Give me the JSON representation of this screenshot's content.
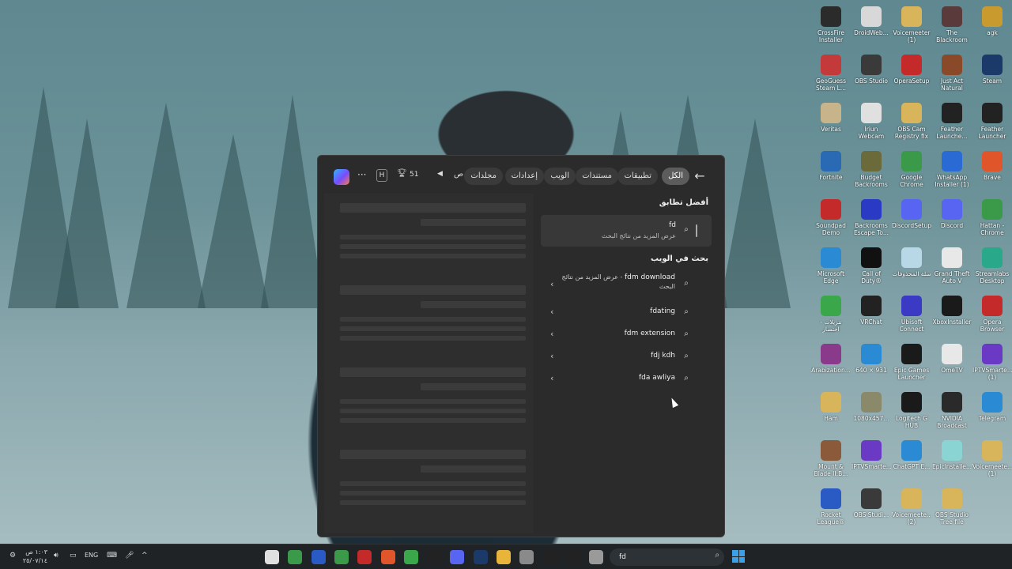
{
  "search_panel": {
    "back_icon": "arrow-left-icon",
    "filters": [
      "الكل",
      "تطبيقات",
      "مستندات",
      "الويب",
      "إعدادات",
      "مجلدات"
    ],
    "active_filter": "الكل",
    "overflow_label": "ص",
    "rewards_points": "51",
    "more_label": "···",
    "profile_initial": "H",
    "best_match": {
      "heading": "أفضل تطابق",
      "query": "fd",
      "subtitle": "عرض المزيد من نتائج البحث"
    },
    "web_search": {
      "heading": "بحث في الويب",
      "suggestions": [
        {
          "text": "fdm download",
          "extra": "- عرض المزيد من نتائج البحث"
        },
        {
          "text": "fdating",
          "extra": ""
        },
        {
          "text": "fdm extension",
          "extra": ""
        },
        {
          "text": "fdj kdh",
          "extra": ""
        },
        {
          "text": "fda awliya",
          "extra": ""
        }
      ]
    }
  },
  "desktop_icons": [
    {
      "label": "CrossFire Installer",
      "color": "#2b2b2b"
    },
    {
      "label": "DroidWeb...",
      "color": "#d8d8d8"
    },
    {
      "label": "Voicemeeter (1)",
      "color": "#d8b45a"
    },
    {
      "label": "The Blackroom",
      "color": "#5a3a3a"
    },
    {
      "label": "agk",
      "color": "#c99a2e"
    },
    {
      "label": "GeoGuess Steam L...",
      "color": "#c43a3a"
    },
    {
      "label": "OBS Studio",
      "color": "#3a3a3a"
    },
    {
      "label": "OperaSetup",
      "color": "#c42a2a"
    },
    {
      "label": "Just Act Natural",
      "color": "#8a4a2a"
    },
    {
      "label": "Steam",
      "color": "#1b3a6a"
    },
    {
      "label": "Veritas",
      "color": "#c8b48a"
    },
    {
      "label": "Iriun Webcam",
      "color": "#e0e0e0"
    },
    {
      "label": "OBS Cam Registry fix",
      "color": "#d8b45a"
    },
    {
      "label": "Feather Launche...",
      "color": "#222222"
    },
    {
      "label": "Feather Launcher",
      "color": "#222222"
    },
    {
      "label": "Fortnite",
      "color": "#2a6ab4"
    },
    {
      "label": "Budget Backrooms",
      "color": "#6a6a3a"
    },
    {
      "label": "Google Chrome",
      "color": "#3a9a4a"
    },
    {
      "label": "WhatsApp Installer (1)",
      "color": "#2a6ad4"
    },
    {
      "label": "Brave",
      "color": "#e0552a"
    },
    {
      "label": "Soundpad Demo",
      "color": "#c42a2a"
    },
    {
      "label": "Backrooms Escape To...",
      "color": "#2a3ac4"
    },
    {
      "label": "DiscordSetup",
      "color": "#5865f2"
    },
    {
      "label": "Discord",
      "color": "#5865f2"
    },
    {
      "label": "Hattan - Chrome",
      "color": "#3a9a4a"
    },
    {
      "label": "Microsoft Edge",
      "color": "#2a8ad4"
    },
    {
      "label": "Call of Duty®",
      "color": "#111111"
    },
    {
      "label": "سلة المحذوفات",
      "color": "#b8d8e8"
    },
    {
      "label": "Grand Theft Auto V",
      "color": "#e8e8e8"
    },
    {
      "label": "Streamlabs Desktop",
      "color": "#2aa88a"
    },
    {
      "label": "تنزيلات - اختصار",
      "color": "#3aa84a"
    },
    {
      "label": "VRChat",
      "color": "#222222"
    },
    {
      "label": "Ubisoft Connect",
      "color": "#3a3ac4"
    },
    {
      "label": "XboxInstaller",
      "color": "#1a1a1a"
    },
    {
      "label": "Opera Browser",
      "color": "#c42a2a"
    },
    {
      "label": "Arabization...",
      "color": "#8a3a8a"
    },
    {
      "label": "640 × 931",
      "color": "#2a8ad4"
    },
    {
      "label": "Epic Games Launcher",
      "color": "#1a1a1a"
    },
    {
      "label": "OmeTV",
      "color": "#e8e8e8"
    },
    {
      "label": "IPTVSmarte... (1)",
      "color": "#6a3ac4"
    },
    {
      "label": "Ham",
      "color": "#d8b45a"
    },
    {
      "label": "1080x457...",
      "color": "#8a8a6a"
    },
    {
      "label": "Logitech G HUB",
      "color": "#1a1a1a"
    },
    {
      "label": "NVIDIA Broadcast",
      "color": "#2a2a2a"
    },
    {
      "label": "Telegram",
      "color": "#2a8ad4"
    },
    {
      "label": "Mount & Blade II:B...",
      "color": "#8a5a3a"
    },
    {
      "label": "IPTVSmarte...",
      "color": "#6a3ac4"
    },
    {
      "label": "ChatGPT E...",
      "color": "#2a8ad4"
    },
    {
      "label": "EpicInstalle...",
      "color": "#8ad4d4"
    },
    {
      "label": "Voicemeete... (1)",
      "color": "#d8b45a"
    },
    {
      "label": "Rocket League®",
      "color": "#2a5ac4"
    },
    {
      "label": "OBS Studi...",
      "color": "#3a3a3a"
    },
    {
      "label": "Voicemeete... (2)",
      "color": "#d8b45a"
    },
    {
      "label": "OBS Studio Tree file",
      "color": "#d8b45a"
    }
  ],
  "taskbar": {
    "search_value": "fd",
    "language": "ENG",
    "clock_time": "١:٠٣ ص",
    "clock_date": "٢٥/٠٧/١٤",
    "pinned_apps": [
      {
        "name": "app-1",
        "color": "#e0e0e0"
      },
      {
        "name": "chrome",
        "color": "#3a9a4a"
      },
      {
        "name": "security",
        "color": "#2a5ac4"
      },
      {
        "name": "chrome-2",
        "color": "#3a9a4a"
      },
      {
        "name": "player",
        "color": "#c42a2a"
      },
      {
        "name": "brave",
        "color": "#e0552a"
      },
      {
        "name": "xbox",
        "color": "#3aa84a"
      },
      {
        "name": "epic",
        "color": "#222222"
      },
      {
        "name": "discord",
        "color": "#5865f2"
      },
      {
        "name": "steam",
        "color": "#1b3a6a"
      },
      {
        "name": "explorer",
        "color": "#e8b43a"
      },
      {
        "name": "store",
        "color": "#8a8a8a"
      },
      {
        "name": "crossfire",
        "color": "#222222"
      },
      {
        "name": "feather",
        "color": "#222222"
      },
      {
        "name": "window",
        "color": "#9a9a9a"
      }
    ]
  }
}
